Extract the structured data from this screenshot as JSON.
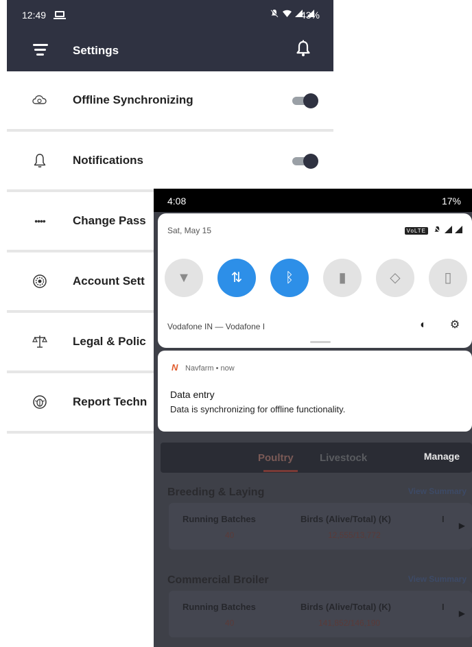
{
  "left_phone": {
    "status": {
      "time": "12:49",
      "battery": "43%"
    },
    "appbar": {
      "title": "Settings"
    },
    "settings": [
      {
        "label": "Offline Synchronizing",
        "icon": "cloud-sync-icon",
        "toggle": true
      },
      {
        "label": "Notifications",
        "icon": "bell-outline-icon",
        "toggle": true
      },
      {
        "label": "Change Pass",
        "icon": "password-dots-icon",
        "toggle": false
      },
      {
        "label": "Account Sett",
        "icon": "account-settings-icon",
        "toggle": false
      },
      {
        "label": "Legal & Polic",
        "icon": "scales-icon",
        "toggle": false
      },
      {
        "label": "Report Techn",
        "icon": "bug-icon",
        "toggle": false
      }
    ]
  },
  "right_phone": {
    "status": {
      "time": "4:08",
      "battery": "17%"
    },
    "quick_settings": {
      "date": "Sat, May 15",
      "volte": "VoLTE",
      "carrier": "Vodafone IN — Vodafone I",
      "tiles": [
        {
          "name": "wifi-tile",
          "icon": "wifi-icon",
          "glyph": "▼",
          "on": false
        },
        {
          "name": "mobile-data-tile",
          "icon": "data-arrows-icon",
          "glyph": "⇅",
          "on": true
        },
        {
          "name": "bluetooth-tile",
          "icon": "bluetooth-icon",
          "glyph": "ᛒ",
          "on": true
        },
        {
          "name": "flashlight-tile",
          "icon": "flashlight-icon",
          "glyph": "▮",
          "on": false
        },
        {
          "name": "auto-rotate-tile",
          "icon": "rotate-icon",
          "glyph": "◇",
          "on": false
        },
        {
          "name": "battery-saver-tile",
          "icon": "battery-saver-icon",
          "glyph": "▯",
          "on": false
        }
      ]
    },
    "notification": {
      "app": "Navfarm • now",
      "title": "Data entry",
      "text": "Data is synchronizing for offline functionality."
    },
    "app_behind": {
      "tabs": [
        "Poultry",
        "Livestock"
      ],
      "manage": "Manage",
      "sections": [
        {
          "title": "Breeding & Laying",
          "link": "View Summary",
          "cols": [
            "Running Batches",
            "Birds (Alive/Total) (K)",
            "I"
          ],
          "vals": [
            "40",
            "12,555/13,772"
          ]
        },
        {
          "title": "Commercial Broiler",
          "link": "View Summary",
          "cols": [
            "Running Batches",
            "Birds (Alive/Total) (K)",
            "I"
          ],
          "vals": [
            "40",
            "141,852/146,190"
          ]
        }
      ]
    }
  },
  "colors": {
    "appbar": "#2f3241",
    "tile_on": "#2d8fe8",
    "tile_off": "#e3e3e3"
  }
}
